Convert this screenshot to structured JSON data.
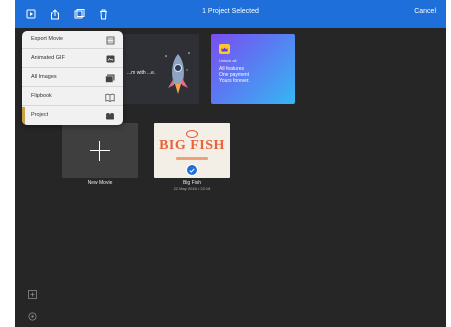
{
  "toolbar": {
    "title": "1 Project Selected",
    "cancel_label": "Cancel",
    "icons": [
      "import-icon",
      "share-icon",
      "duplicate-icon",
      "trash-icon"
    ]
  },
  "share_menu": {
    "items": [
      {
        "label": "Export Movie",
        "icon": "film-icon"
      },
      {
        "label": "Animated GIF",
        "icon": "gif-icon"
      },
      {
        "label": "All Images",
        "icon": "images-icon"
      },
      {
        "label": "Flipbook",
        "icon": "book-icon"
      },
      {
        "label": "Project",
        "icon": "project-icon"
      }
    ]
  },
  "banners": {
    "promo_text": "...m with ...e.",
    "upgrade": {
      "lines": [
        "Unlock all",
        "All features",
        "One payment",
        "Yours forever."
      ]
    }
  },
  "projects": [
    {
      "name": "New Movie",
      "date": ""
    },
    {
      "name": "Big Fish",
      "date": "22 May 2018 • 22:18",
      "thumb_title": "BIG FISH"
    }
  ],
  "colors": {
    "accent": "#1e6fd9",
    "background": "#262626",
    "menu": "#f1f1f1",
    "logo": "#e8633a"
  }
}
